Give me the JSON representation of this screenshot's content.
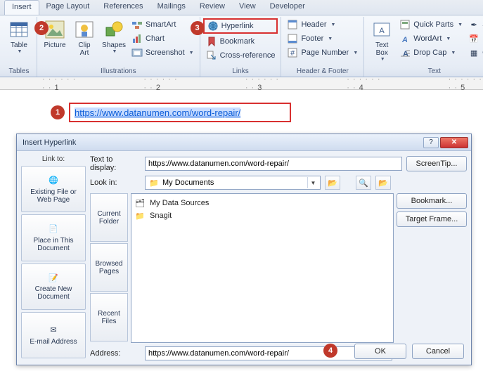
{
  "tabs": [
    "Insert",
    "Page Layout",
    "References",
    "Mailings",
    "Review",
    "View",
    "Developer"
  ],
  "active_tab": 0,
  "ribbon": {
    "tables": {
      "label": "Tables",
      "table": "Table"
    },
    "illustrations": {
      "label": "Illustrations",
      "picture": "Picture",
      "clipart": "Clip\nArt",
      "shapes": "Shapes",
      "smartart": "SmartArt",
      "chart": "Chart",
      "screenshot": "Screenshot"
    },
    "links": {
      "label": "Links",
      "hyperlink": "Hyperlink",
      "bookmark": "Bookmark",
      "crossref": "Cross-reference"
    },
    "headerfooter": {
      "label": "Header & Footer",
      "header": "Header",
      "footer": "Footer",
      "pagenum": "Page Number"
    },
    "text": {
      "label": "Text",
      "textbox": "Text\nBox",
      "quickparts": "Quick Parts",
      "wordart": "WordArt",
      "dropcap": "Drop Cap",
      "sign": "Sign",
      "date": "Date",
      "obj": "Obje"
    }
  },
  "ruler_ticks": [
    "1",
    "2",
    "3",
    "4",
    "5"
  ],
  "doc_url": "https://www.datanumen.com/word-repair/",
  "callouts": {
    "one": "1",
    "two": "2",
    "three": "3",
    "four": "4"
  },
  "dialog": {
    "title": "Insert Hyperlink",
    "link_to": "Link to:",
    "text_to_display_label": "Text to display:",
    "text_to_display": "https://www.datanumen.com/word-repair/",
    "screentip": "ScreenTip...",
    "nav": {
      "existing": "Existing File or\nWeb Page",
      "place": "Place in This\nDocument",
      "createnew": "Create New\nDocument",
      "email": "E-mail Address"
    },
    "lookin_label": "Look in:",
    "lookin_value": "My Documents",
    "subnav": {
      "current": "Current\nFolder",
      "browsed": "Browsed\nPages",
      "recent": "Recent\nFiles"
    },
    "files": [
      "My Data Sources",
      "Snagit"
    ],
    "bookmark": "Bookmark...",
    "targetframe": "Target Frame...",
    "address_label": "Address:",
    "address_value": "https://www.datanumen.com/word-repair/",
    "ok": "OK",
    "cancel": "Cancel"
  }
}
